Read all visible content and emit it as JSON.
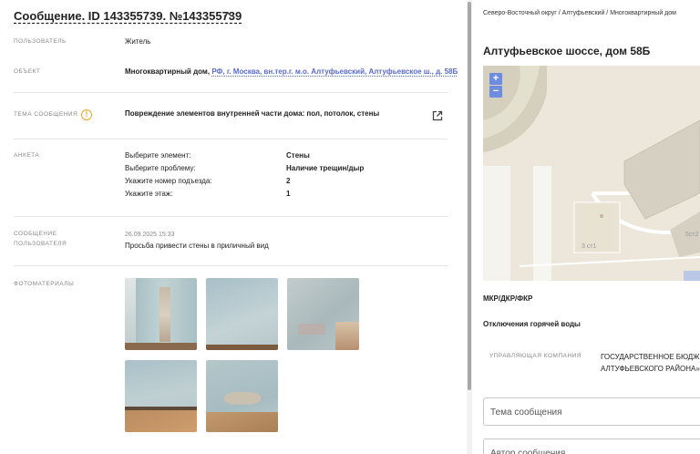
{
  "message": {
    "title": "Сообщение. ID 143355739. №143355739",
    "rows": {
      "user_label": "ПОЛЬЗОВАТЕЛЬ",
      "user_value": "Житель",
      "object_label": "ОБЪЕКТ",
      "object_prefix": "Многоквартирный дом,",
      "object_link": "РФ, г. Москва, вн.тер.г. м.о. Алтуфьевский, Алтуфьевское ш., д. 58Б",
      "topic_label": "ТЕМА СООБЩЕНИЯ",
      "topic_value": "Повреждение элементов внутренней части дома: пол, потолок, стены",
      "survey_label": "АНКЕТА",
      "survey": [
        {
          "q": "Выберите элемент:",
          "a": "Стены"
        },
        {
          "q": "Выберите проблему:",
          "a": "Наличие трещин/дыр"
        },
        {
          "q": "Укажите номер подъезда:",
          "a": "2"
        },
        {
          "q": "Укажите этаж:",
          "a": "1"
        }
      ],
      "user_msg_label_1": "СООБЩЕНИЕ",
      "user_msg_label_2": "ПОЛЬЗОВАТЕЛЯ",
      "user_msg_date": "26.09.2025 15:33",
      "user_msg_text": "Просьба привести стены в приличный вид",
      "photos_label": "ФОТОМАТЕРИАЛЫ"
    },
    "icons": {
      "warning": "warning-icon",
      "external": "external-link-icon",
      "collapse": "chevron-up-icon"
    }
  },
  "side": {
    "breadcrumb": "Северо-Восточный округ / Алтуфьевский / Многоквартирный дом",
    "address": "Алтуфьевское шоссе, дом 58Б",
    "map": {
      "zoom_in": "+",
      "zoom_out": "−",
      "label_building": "3 ст1",
      "label_building2": "5ст2"
    },
    "mkd_label": "МКР/ДКР/ФКР",
    "hot_water": "Отключения горячей воды",
    "mgmt_label": "УПРАВЛЯЮЩАЯ КОМПАНИЯ",
    "mgmt_value_1": "ГОСУДАРСТВЕННОЕ БЮДЖЕ",
    "mgmt_value_2": "АЛТУФЬЕВСКОГО РАЙОНА»",
    "topic_placeholder": "Тема сообщения",
    "author_placeholder": "Автор сообщения"
  }
}
